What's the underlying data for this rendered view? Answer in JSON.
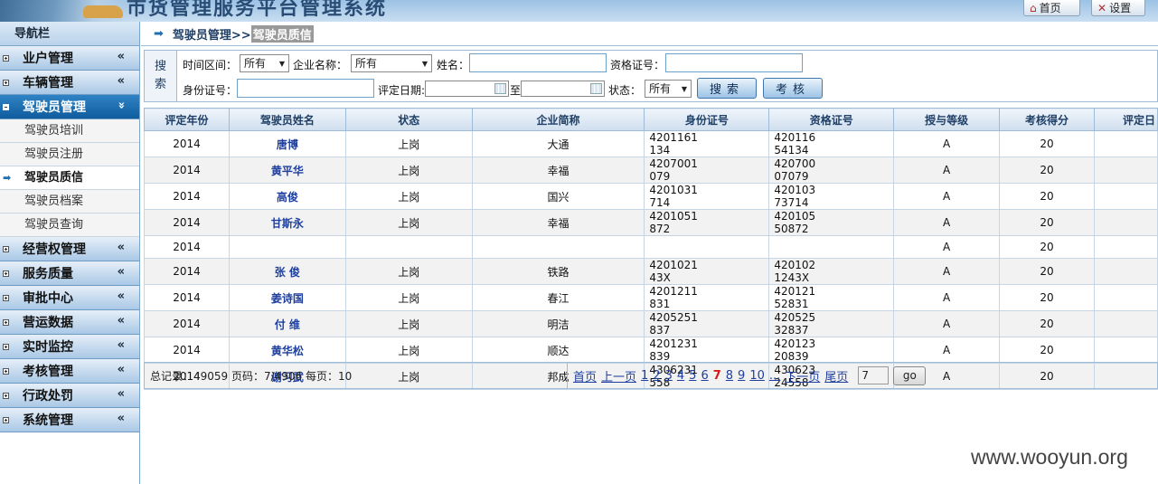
{
  "header": {
    "banner_title": "市货管理服务平台管理系统",
    "home_label": "首页",
    "settings_label": "设置"
  },
  "sidebar": {
    "title": "导航栏",
    "menus": [
      {
        "label": "业户管理",
        "collapsed": true
      },
      {
        "label": "车辆管理",
        "collapsed": true
      },
      {
        "label": "驾驶员管理",
        "collapsed": false,
        "active": true,
        "items": [
          "驾驶员培训",
          "驾驶员注册",
          "驾驶员质信",
          "驾驶员档案",
          "驾驶员查询"
        ],
        "current_item": "驾驶员质信"
      },
      {
        "label": "经营权管理",
        "collapsed": true
      },
      {
        "label": "服务质量",
        "collapsed": true
      },
      {
        "label": "审批中心",
        "collapsed": true
      },
      {
        "label": "营运数据",
        "collapsed": true
      },
      {
        "label": "实时监控",
        "collapsed": true
      },
      {
        "label": "考核管理",
        "collapsed": true
      },
      {
        "label": "行政处罚",
        "collapsed": true
      },
      {
        "label": "系统管理",
        "collapsed": true
      }
    ],
    "chevron_closed": "«",
    "chevron_open": "»"
  },
  "breadcrumb": {
    "parent": "驾驶员管理>>",
    "current": "驾驶员质信"
  },
  "search": {
    "side_label_1": "搜",
    "side_label_2": "索",
    "period_label": "时间区间：",
    "period_value": "所有",
    "company_label": "企业名称：",
    "company_value": "所有",
    "name_label": "姓名：",
    "name_value": "",
    "qual_label": "资格证号：",
    "qual_value": "",
    "id_label": "身份证号：",
    "id_value": "",
    "date_label": "评定日期:",
    "date_to": "至",
    "status_label": "状态：",
    "status_value": "所有",
    "search_button": "搜索",
    "assess_button": "考核"
  },
  "table": {
    "columns": [
      "评定年份",
      "驾驶员姓名",
      "状态",
      "企业简称",
      "身份证号",
      "资格证号",
      "授与等级",
      "考核得分",
      "评定日"
    ],
    "rows": [
      [
        "2014",
        "唐博",
        "上岗",
        "大通",
        "4201161",
        "134",
        "420116",
        "54134",
        "A",
        "20",
        ""
      ],
      [
        "2014",
        "黄平华",
        "上岗",
        "幸福",
        "4207001",
        "079",
        "420700",
        "07079",
        "A",
        "20",
        ""
      ],
      [
        "2014",
        "高俊",
        "上岗",
        "国兴",
        "4201031",
        "714",
        "420103",
        "73714",
        "A",
        "20",
        ""
      ],
      [
        "2014",
        "甘斯永",
        "上岗",
        "幸福",
        "4201051",
        "872",
        "420105",
        "50872",
        "A",
        "20",
        ""
      ],
      [
        "2014",
        "",
        "",
        "",
        "",
        "",
        "",
        "",
        "A",
        "20",
        ""
      ],
      [
        "2014",
        "张 俊",
        "上岗",
        "铁路",
        "4201021",
        "43X",
        "420102",
        "1243X",
        "A",
        "20",
        ""
      ],
      [
        "2014",
        "姜诗国",
        "上岗",
        "春江",
        "4201211",
        "831",
        "420121",
        "52831",
        "A",
        "20",
        ""
      ],
      [
        "2014",
        "付 维",
        "上岗",
        "明洁",
        "4205251",
        "837",
        "420525",
        "32837",
        "A",
        "20",
        ""
      ],
      [
        "2014",
        "黄华松",
        "上岗",
        "顺达",
        "4201231",
        "839",
        "420123",
        "20839",
        "A",
        "20",
        ""
      ],
      [
        "2014",
        "谢习武",
        "上岗",
        "邦成",
        "4306231",
        "558",
        "430623",
        "24558",
        "A",
        "20",
        ""
      ]
    ]
  },
  "pager": {
    "summary": "总记录：49059 页码：7/4906 每页：10",
    "first": "首页",
    "prev": "上一页",
    "pages": [
      "1",
      "2",
      "3",
      "4",
      "5",
      "6",
      "7",
      "8",
      "9",
      "10",
      "..."
    ],
    "current_page": "7",
    "next": "下一页",
    "last": "尾页",
    "jump_value": "7",
    "go_label": "go"
  },
  "watermark": "www.wooyun.org",
  "colors": {
    "menu_active": "#1565a8",
    "link": "#1e3f9e",
    "current_page": "#d81818"
  }
}
